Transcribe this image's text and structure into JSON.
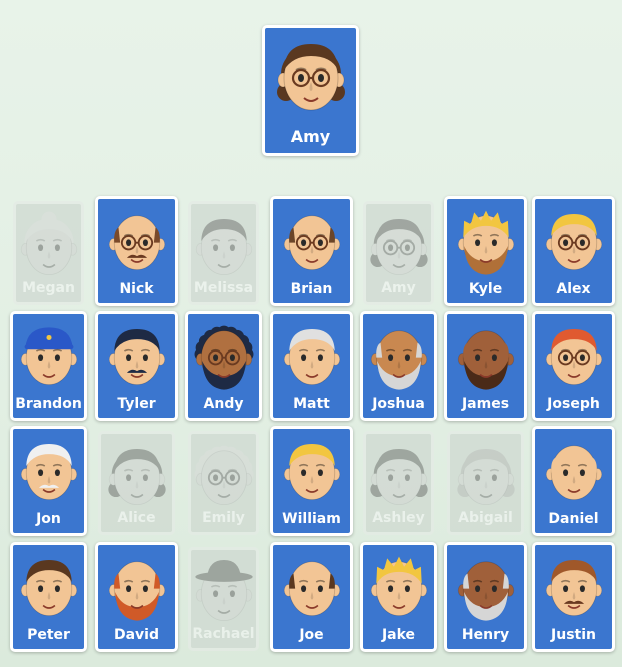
{
  "target": {
    "name": "Amy",
    "hair": "#5a3820",
    "hair_style": "bob",
    "skin": "#f2c595",
    "glasses": true
  },
  "board": [
    {
      "name": "Megan",
      "up": false,
      "skin": "#f1cfa9",
      "hair": "#e9dcc8",
      "hair_style": "bun"
    },
    {
      "name": "Nick",
      "up": true,
      "skin": "#f2c595",
      "hair": "#7a4a2a",
      "hair_style": "bald",
      "glasses": true,
      "mustache": "#6a3a20"
    },
    {
      "name": "Melissa",
      "up": false,
      "skin": "#f1cfa9",
      "hair": "#4a3020",
      "hair_style": "short"
    },
    {
      "name": "Brian",
      "up": true,
      "skin": "#f2c595",
      "hair": "#6b4528",
      "hair_style": "bald",
      "glasses": true
    },
    {
      "name": "Amy",
      "up": false,
      "skin": "#f1cfa9",
      "hair": "#4a3020",
      "hair_style": "bob",
      "glasses": true
    },
    {
      "name": "Kyle",
      "up": true,
      "skin": "#f2c595",
      "hair": "#f2c640",
      "hair_style": "spiky",
      "beard": "#b07038"
    },
    {
      "name": "Alex",
      "up": true,
      "skin": "#f2c595",
      "hair": "#f2c640",
      "hair_style": "short",
      "glasses": true
    },
    {
      "name": "Brandon",
      "up": true,
      "skin": "#f2c595",
      "hair": "#2a58c8",
      "hair_style": "cap"
    },
    {
      "name": "Tyler",
      "up": true,
      "skin": "#f2c595",
      "hair": "#1e2a44",
      "hair_style": "short",
      "mustache": "#1e2a44"
    },
    {
      "name": "Andy",
      "up": true,
      "skin": "#b07040",
      "hair": "#1e2a44",
      "hair_style": "curly",
      "glasses": true,
      "beard": "#1e2a44"
    },
    {
      "name": "Matt",
      "up": true,
      "skin": "#f2c595",
      "hair": "#e0e0e0",
      "hair_style": "short"
    },
    {
      "name": "Joshua",
      "up": true,
      "skin": "#c98850",
      "hair": "#d6d6d6",
      "hair_style": "bald",
      "beard": "#d6d6d6"
    },
    {
      "name": "James",
      "up": true,
      "skin": "#a0603a",
      "hair": "#a0603a",
      "hair_style": "bald",
      "beard": "#4a2a18"
    },
    {
      "name": "Joseph",
      "up": true,
      "skin": "#f2c595",
      "hair": "#e05a30",
      "hair_style": "short",
      "glasses": true
    },
    {
      "name": "Jon",
      "up": true,
      "skin": "#f2c595",
      "hair": "#f0f0f0",
      "hair_style": "short",
      "mustache": "#f0f0f0"
    },
    {
      "name": "Alice",
      "up": false,
      "skin": "#f1cfa9",
      "hair": "#4a3020",
      "hair_style": "bob"
    },
    {
      "name": "Emily",
      "up": false,
      "skin": "#f1cfa9",
      "hair": "#e9dcc8",
      "hair_style": "curly",
      "glasses": true
    },
    {
      "name": "William",
      "up": true,
      "skin": "#f2c595",
      "hair": "#f2c640",
      "hair_style": "short"
    },
    {
      "name": "Ashley",
      "up": false,
      "skin": "#f1cfa9",
      "hair": "#4a3020",
      "hair_style": "bob"
    },
    {
      "name": "Abigail",
      "up": false,
      "skin": "#f1cfa9",
      "hair": "#e0a060",
      "hair_style": "long"
    },
    {
      "name": "Daniel",
      "up": true,
      "skin": "#f2c595",
      "hair": "#f2c595",
      "hair_style": "bald"
    },
    {
      "name": "Peter",
      "up": true,
      "skin": "#f2c595",
      "hair": "#5a3820",
      "hair_style": "short"
    },
    {
      "name": "David",
      "up": true,
      "skin": "#f2c595",
      "hair": "#d05a28",
      "hair_style": "bald",
      "beard": "#d05a28"
    },
    {
      "name": "Rachael",
      "up": false,
      "skin": "#f1cfa9",
      "hair": "#4a3020",
      "hair_style": "hat"
    },
    {
      "name": "Joe",
      "up": true,
      "skin": "#f2c595",
      "hair": "#5a3820",
      "hair_style": "bald"
    },
    {
      "name": "Jake",
      "up": true,
      "skin": "#f2c595",
      "hair": "#f2c640",
      "hair_style": "spiky"
    },
    {
      "name": "Henry",
      "up": true,
      "skin": "#a0603a",
      "hair": "#d6d6d6",
      "hair_style": "bald",
      "beard": "#d6d6d6"
    },
    {
      "name": "Justin",
      "up": true,
      "skin": "#f2c595",
      "hair": "#a0582a",
      "hair_style": "short",
      "mustache": "#6a3a20"
    }
  ]
}
